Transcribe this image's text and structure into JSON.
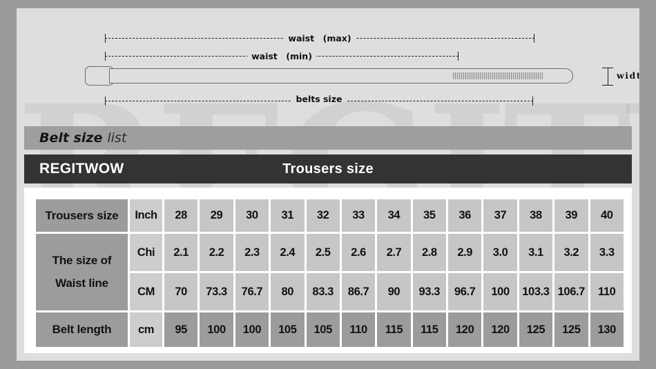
{
  "watermark": "REGITWOW",
  "diagram": {
    "waist_max_label": "waist　(max)",
    "waist_min_label": "waist　(min)",
    "belts_size_label": "belts size",
    "width_label": "width",
    "buckle_name": "belt-buckle",
    "strap_name": "belt-strap",
    "holes_name": "belt-holes"
  },
  "bars": {
    "belt_size_bold": "Belt size",
    "belt_size_light": "list",
    "brand": "REGITWOW",
    "trousers_title": "Trousers size"
  },
  "table": {
    "row_head_1": "Trousers size",
    "row_head_2_line1": "The size of",
    "row_head_2_line2": "Waist line",
    "row_head_3": "Belt length",
    "units": {
      "inch": "Inch",
      "chi": "Chi",
      "cm_upper": "CM",
      "cm_lower": "cm"
    },
    "trousers_size": [
      "28",
      "29",
      "30",
      "31",
      "32",
      "33",
      "34",
      "35",
      "36",
      "37",
      "38",
      "39",
      "40"
    ],
    "waist_chi": [
      "2.1",
      "2.2",
      "2.3",
      "2.4",
      "2.5",
      "2.6",
      "2.7",
      "2.8",
      "2.9",
      "3.0",
      "3.1",
      "3.2",
      "3.3"
    ],
    "waist_cm": [
      "70",
      "73.3",
      "76.7",
      "80",
      "83.3",
      "86.7",
      "90",
      "93.3",
      "96.7",
      "100",
      "103.3",
      "106.7",
      "110"
    ],
    "belt_length": [
      "95",
      "100",
      "100",
      "105",
      "105",
      "110",
      "115",
      "115",
      "120",
      "120",
      "125",
      "125",
      "130"
    ]
  },
  "colors": {
    "page_bg": "#dedede",
    "outer_bg": "#9a9a9a",
    "bar_gray": "#9e9e9e",
    "bar_dark": "#333333",
    "cell_light": "#c6c6c6",
    "cell_unit": "#cdcdcd",
    "cell_dark": "#9c9c9c",
    "table_frame": "#ffffff"
  }
}
